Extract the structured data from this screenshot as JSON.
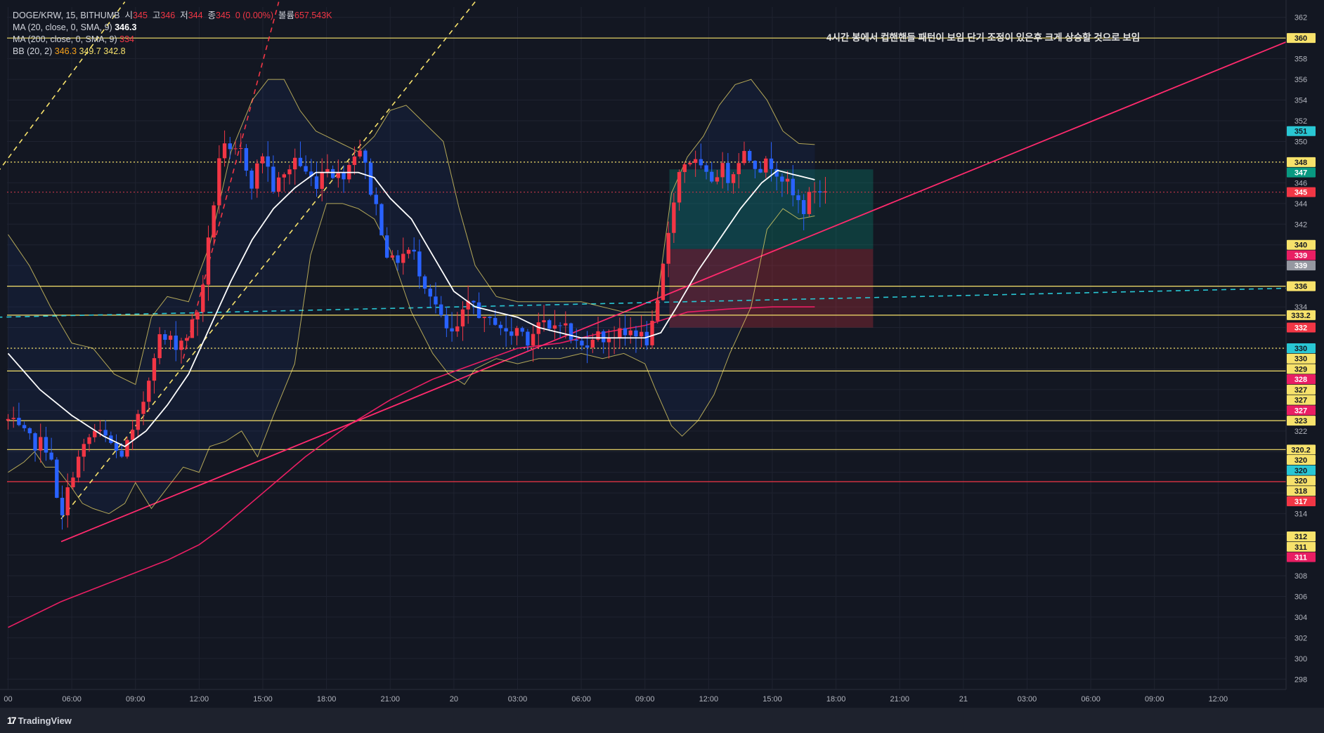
{
  "legend": {
    "symbol": "DOGE/KRW, 15, BITHUMB",
    "o_label": "시",
    "o_value": "345",
    "h_label": "고",
    "h_value": "346",
    "l_label": "저",
    "l_value": "344",
    "c_label": "종",
    "c_value": "345",
    "change": "0 (0.00%)",
    "vol_label": "볼륨",
    "vol_value": "657.543K",
    "ma20_label": "MA (20, close, 0, SMA, 9)",
    "ma20_value": "346.3",
    "ma200_label": "MA (200, close, 0, SMA, 9)",
    "ma200_value": "334",
    "bb_label": "BB (20, 2)",
    "bb_basis": "346.3",
    "bb_upper": "349.7",
    "bb_lower": "342.8"
  },
  "annotation": "4시간 봉에서 컵핸핸들 패턴이 보임  단기 조정이 있은후 크게 상승할 것으로 보임",
  "brand": {
    "logo": "17",
    "name": "TradingView"
  },
  "colors": {
    "bg": "#131722",
    "grid": "#1f2330",
    "up": "#f23645",
    "down": "#2962ff",
    "text": "#b2b5be"
  },
  "chart_data": {
    "type": "candlestick",
    "ylim": [
      297,
      363
    ],
    "y_ticks": [
      298,
      300,
      302,
      304,
      306,
      308,
      310,
      312,
      314,
      316,
      318,
      320,
      322,
      324,
      326,
      328,
      330,
      332,
      334,
      336,
      338,
      340,
      342,
      344,
      346,
      348,
      350,
      352,
      354,
      356,
      358,
      360,
      362
    ],
    "x_ticks": [
      {
        "t": 0,
        "label": "00"
      },
      {
        "t": 6,
        "label": "06:00"
      },
      {
        "t": 12,
        "label": "09:00"
      },
      {
        "t": 18,
        "label": "12:00"
      },
      {
        "t": 24,
        "label": "15:00"
      },
      {
        "t": 30,
        "label": "18:00"
      },
      {
        "t": 36,
        "label": "21:00"
      },
      {
        "t": 42,
        "label": "20"
      },
      {
        "t": 48,
        "label": "03:00"
      },
      {
        "t": 54,
        "label": "06:00"
      },
      {
        "t": 60,
        "label": "09:00"
      },
      {
        "t": 66,
        "label": "12:00"
      },
      {
        "t": 72,
        "label": "15:00"
      },
      {
        "t": 78,
        "label": "18:00"
      },
      {
        "t": 84,
        "label": "21:00"
      },
      {
        "t": 90,
        "label": "21"
      },
      {
        "t": 96,
        "label": "03:00"
      },
      {
        "t": 102,
        "label": "06:00"
      },
      {
        "t": 108,
        "label": "09:00"
      },
      {
        "t": 114,
        "label": "12:00"
      }
    ],
    "price_keypoints": [
      [
        0,
        323.0
      ],
      [
        2,
        321.0
      ],
      [
        4,
        320.5
      ],
      [
        4.5,
        315.5
      ],
      [
        5,
        313.0
      ],
      [
        6,
        318.0
      ],
      [
        8,
        322.0
      ],
      [
        9.5,
        321.0
      ],
      [
        10.5,
        319.5
      ],
      [
        12,
        322.0
      ],
      [
        13,
        326.0
      ],
      [
        14,
        331.0
      ],
      [
        16,
        330.5
      ],
      [
        17,
        331.5
      ],
      [
        18,
        334.0
      ],
      [
        19,
        341.0
      ],
      [
        20,
        349.5
      ],
      [
        21,
        348.5
      ],
      [
        22,
        349.0
      ],
      [
        23,
        346.0
      ],
      [
        24,
        349.0
      ],
      [
        25,
        345.5
      ],
      [
        26,
        346.5
      ],
      [
        27,
        348.5
      ],
      [
        28,
        347.0
      ],
      [
        29,
        346.0
      ],
      [
        30,
        348.0
      ],
      [
        31,
        346.5
      ],
      [
        32,
        347.5
      ],
      [
        33,
        350.0
      ],
      [
        34,
        346.0
      ],
      [
        35,
        342.5
      ],
      [
        36,
        338.0
      ],
      [
        37,
        339.0
      ],
      [
        38,
        339.5
      ],
      [
        39,
        337.0
      ],
      [
        40,
        335.0
      ],
      [
        41,
        332.0
      ],
      [
        42,
        331.0
      ],
      [
        43,
        333.5
      ],
      [
        44,
        334.5
      ],
      [
        45,
        332.0
      ],
      [
        46,
        333.0
      ],
      [
        47,
        331.0
      ],
      [
        48,
        332.0
      ],
      [
        49,
        331.0
      ],
      [
        50,
        332.5
      ],
      [
        51,
        331.5
      ],
      [
        52,
        333.0
      ],
      [
        53,
        331.0
      ],
      [
        54,
        330.0
      ],
      [
        55,
        331.5
      ],
      [
        56,
        331.0
      ],
      [
        57,
        331.5
      ],
      [
        58,
        331.0
      ],
      [
        59,
        332.0
      ],
      [
        60,
        330.5
      ],
      [
        61,
        332.5
      ],
      [
        62,
        340.0
      ],
      [
        63,
        346.5
      ],
      [
        64,
        348.5
      ],
      [
        65,
        347.5
      ],
      [
        66,
        346.0
      ],
      [
        67,
        347.5
      ],
      [
        68,
        346.5
      ],
      [
        69,
        349.0
      ],
      [
        70,
        348.5
      ],
      [
        71,
        347.5
      ],
      [
        72,
        348.0
      ],
      [
        73,
        346.5
      ],
      [
        74,
        344.5
      ],
      [
        75,
        343.5
      ],
      [
        76,
        345.5
      ],
      [
        77,
        345.0
      ]
    ],
    "candle_count": 152,
    "last_candle_t": 77,
    "ma20_keypoints": [
      [
        0,
        329.5
      ],
      [
        3,
        326.0
      ],
      [
        6,
        323.5
      ],
      [
        9,
        321.5
      ],
      [
        11,
        320.5
      ],
      [
        13,
        322.0
      ],
      [
        15,
        324.5
      ],
      [
        17,
        327.5
      ],
      [
        19,
        332.0
      ],
      [
        21,
        336.5
      ],
      [
        23,
        340.5
      ],
      [
        25,
        343.5
      ],
      [
        27,
        345.5
      ],
      [
        29,
        347.0
      ],
      [
        31,
        347.0
      ],
      [
        33,
        347.0
      ],
      [
        34.5,
        346.5
      ],
      [
        36,
        344.5
      ],
      [
        38,
        342.5
      ],
      [
        40,
        339.0
      ],
      [
        42,
        335.5
      ],
      [
        44,
        334.0
      ],
      [
        46,
        333.5
      ],
      [
        48,
        333.0
      ],
      [
        50,
        332.0
      ],
      [
        52,
        331.5
      ],
      [
        54,
        331.0
      ],
      [
        56,
        331.0
      ],
      [
        58,
        331.0
      ],
      [
        60,
        331.0
      ],
      [
        61.5,
        331.5
      ],
      [
        63,
        334.0
      ],
      [
        65,
        337.5
      ],
      [
        67,
        340.5
      ],
      [
        69,
        343.5
      ],
      [
        71,
        346.0
      ],
      [
        72.5,
        347.2
      ],
      [
        74,
        346.8
      ],
      [
        76,
        346.3
      ]
    ],
    "bb_upper_keypoints": [
      [
        0,
        341.0
      ],
      [
        2,
        338.0
      ],
      [
        4,
        334.0
      ],
      [
        6,
        330.5
      ],
      [
        8,
        330.0
      ],
      [
        10,
        327.5
      ],
      [
        12,
        326.5
      ],
      [
        13.5,
        333.0
      ],
      [
        15,
        335.0
      ],
      [
        17,
        334.5
      ],
      [
        19,
        340.0
      ],
      [
        21,
        349.0
      ],
      [
        23,
        354.0
      ],
      [
        24.5,
        356.0
      ],
      [
        26,
        356.0
      ],
      [
        27.5,
        353.0
      ],
      [
        29,
        351.0
      ],
      [
        31,
        350.0
      ],
      [
        33,
        349.0
      ],
      [
        34.5,
        350.5
      ],
      [
        36,
        353.0
      ],
      [
        37.5,
        353.5
      ],
      [
        39,
        352.0
      ],
      [
        41,
        350.0
      ],
      [
        42.5,
        343.5
      ],
      [
        44,
        338.0
      ],
      [
        46,
        335.0
      ],
      [
        48,
        334.5
      ],
      [
        50,
        334.5
      ],
      [
        52,
        334.5
      ],
      [
        54,
        334.5
      ],
      [
        56,
        334.0
      ],
      [
        58,
        333.5
      ],
      [
        60,
        333.5
      ],
      [
        61,
        333.5
      ],
      [
        62.5,
        345.0
      ],
      [
        64,
        348.5
      ],
      [
        65.5,
        350.5
      ],
      [
        67,
        353.5
      ],
      [
        68.5,
        355.5
      ],
      [
        70,
        356.0
      ],
      [
        71.5,
        354.0
      ],
      [
        73,
        351.0
      ],
      [
        74.5,
        349.8
      ],
      [
        76,
        349.7
      ]
    ],
    "bb_lower_keypoints": [
      [
        0,
        318.0
      ],
      [
        1.5,
        319.0
      ],
      [
        2.5,
        320.0
      ],
      [
        3.5,
        318.5
      ],
      [
        4.5,
        318.5
      ],
      [
        6,
        316.5
      ],
      [
        7,
        315.0
      ],
      [
        8,
        314.5
      ],
      [
        9.5,
        314.0
      ],
      [
        11,
        315.0
      ],
      [
        12,
        317.0
      ],
      [
        13.5,
        314.5
      ],
      [
        15,
        316.5
      ],
      [
        16.5,
        318.5
      ],
      [
        18,
        318.0
      ],
      [
        19,
        320.5
      ],
      [
        20.5,
        321.0
      ],
      [
        22,
        322.0
      ],
      [
        23.5,
        319.5
      ],
      [
        25,
        323.5
      ],
      [
        27,
        328.5
      ],
      [
        28.5,
        339.0
      ],
      [
        30,
        344.0
      ],
      [
        31.5,
        344.0
      ],
      [
        33,
        343.5
      ],
      [
        34.5,
        342.5
      ],
      [
        36,
        339.5
      ],
      [
        38,
        333.5
      ],
      [
        40,
        329.5
      ],
      [
        41.5,
        327.5
      ],
      [
        43,
        326.5
      ],
      [
        44,
        328.0
      ],
      [
        46,
        329.0
      ],
      [
        48,
        328.5
      ],
      [
        50,
        329.0
      ],
      [
        52,
        329.0
      ],
      [
        54,
        329.5
      ],
      [
        56,
        329.0
      ],
      [
        58,
        329.5
      ],
      [
        60,
        328.5
      ],
      [
        61,
        326.0
      ],
      [
        62.5,
        322.5
      ],
      [
        63.5,
        321.5
      ],
      [
        65,
        323.0
      ],
      [
        66.5,
        325.5
      ],
      [
        68,
        329.5
      ],
      [
        70,
        334.0
      ],
      [
        71.5,
        341.5
      ],
      [
        73,
        343.5
      ],
      [
        74.5,
        342.5
      ],
      [
        76,
        342.8
      ]
    ],
    "ma200_keypoints": [
      [
        0,
        303.0
      ],
      [
        5,
        305.5
      ],
      [
        10,
        307.5
      ],
      [
        15,
        309.5
      ],
      [
        18,
        311.0
      ],
      [
        20,
        312.5
      ],
      [
        24,
        316.0
      ],
      [
        28,
        319.5
      ],
      [
        32,
        322.5
      ],
      [
        36,
        325.0
      ],
      [
        40,
        327.0
      ],
      [
        44,
        328.5
      ],
      [
        48,
        330.0
      ],
      [
        52,
        330.5
      ],
      [
        56,
        331.5
      ],
      [
        60,
        332.2
      ],
      [
        64,
        333.5
      ],
      [
        68,
        333.8
      ],
      [
        72,
        334.0
      ],
      [
        74,
        334.0
      ],
      [
        76,
        334.0
      ]
    ],
    "horizontal_levels": [
      {
        "price": 360,
        "color": "#f7e26b",
        "style": "solid"
      },
      {
        "price": 348,
        "color": "#f7e26b",
        "style": "dotted"
      },
      {
        "price": 336,
        "color": "#f7e26b",
        "style": "solid"
      },
      {
        "price": 333.2,
        "color": "#f7e26b",
        "style": "solid"
      },
      {
        "price": 330,
        "color": "#f7e26b",
        "style": "dotted"
      },
      {
        "price": 327.8,
        "color": "#f7e26b",
        "style": "solid"
      },
      {
        "price": 323,
        "color": "#f7e26b",
        "style": "solid"
      },
      {
        "price": 320.2,
        "color": "#f7e26b",
        "style": "solid"
      },
      {
        "price": 317.1,
        "color": "#f23645",
        "style": "solid"
      },
      {
        "price": 345.1,
        "color": "#b23445",
        "style": "dotted"
      }
    ],
    "trend_lines": [
      {
        "t1": 5,
        "p1": 311.3,
        "t2": 128,
        "p2": 362.8,
        "color": "#ff2a6d",
        "style": "solid"
      },
      {
        "t1": -1,
        "p1": 333.0,
        "t2": 129,
        "p2": 336.0,
        "color": "#29c7d4",
        "style": "dashed"
      },
      {
        "t1": 5,
        "p1": 313.5,
        "t2": 44,
        "p2": 363.5,
        "color": "#f7e26b",
        "style": "dashed"
      },
      {
        "t1": -1,
        "p1": 347.0,
        "t2": 11,
        "p2": 363.5,
        "color": "#f7e26b",
        "style": "dashed"
      },
      {
        "t1": 16.5,
        "p1": 329.0,
        "t2": 25.5,
        "p2": 363.5,
        "color": "#f23645",
        "style": "dashed"
      }
    ],
    "position_box": {
      "t1": 62.3,
      "t2": 81.5,
      "entry": 339.6,
      "target": 347.3,
      "stop": 332.0
    },
    "price_labels": [
      {
        "price": 360,
        "label": "360",
        "bg": "#f7e26b",
        "fg": "#131722"
      },
      {
        "price": 351,
        "label": "351",
        "bg": "#29c7d4",
        "fg": "#131722"
      },
      {
        "price": 348,
        "label": "348",
        "bg": "#f7e26b",
        "fg": "#131722"
      },
      {
        "price": 347,
        "label": "347",
        "bg": "#089981",
        "fg": "#ffffff"
      },
      {
        "price": 345.1,
        "label": "345",
        "bg": "#f23645",
        "fg": "#ffffff"
      },
      {
        "price": 340,
        "label": "340",
        "bg": "#f7e26b",
        "fg": "#131722"
      },
      {
        "price": 339,
        "label": "339",
        "bg": "#e91e63",
        "fg": "#ffffff"
      },
      {
        "price": 338,
        "label": "339",
        "bg": "#9598a1",
        "fg": "#ffffff"
      },
      {
        "price": 336,
        "label": "336",
        "bg": "#f7e26b",
        "fg": "#131722"
      },
      {
        "price": 333.2,
        "label": "333.2",
        "bg": "#f7e26b",
        "fg": "#131722"
      },
      {
        "price": 332,
        "label": "332",
        "bg": "#f23645",
        "fg": "#ffffff"
      },
      {
        "price": 330,
        "label": "330",
        "bg": "#29c7d4",
        "fg": "#131722"
      },
      {
        "price": 329,
        "label": "330",
        "bg": "#f7e26b",
        "fg": "#131722"
      },
      {
        "price": 328,
        "label": "329",
        "bg": "#f7e26b",
        "fg": "#131722"
      },
      {
        "price": 327,
        "label": "328",
        "bg": "#e91e63",
        "fg": "#ffffff"
      },
      {
        "price": 326,
        "label": "327",
        "bg": "#f7e26b",
        "fg": "#131722"
      },
      {
        "price": 325,
        "label": "327",
        "bg": "#f7e26b",
        "fg": "#131722"
      },
      {
        "price": 324,
        "label": "327",
        "bg": "#e91e63",
        "fg": "#ffffff"
      },
      {
        "price": 323,
        "label": "323",
        "bg": "#f7e26b",
        "fg": "#131722"
      },
      {
        "price": 320.2,
        "label": "320.2",
        "bg": "#f7e26b",
        "fg": "#131722"
      },
      {
        "price": 319.2,
        "label": "320",
        "bg": "#f7e26b",
        "fg": "#131722"
      },
      {
        "price": 318.2,
        "label": "320",
        "bg": "#29c7d4",
        "fg": "#131722"
      },
      {
        "price": 317.2,
        "label": "320",
        "bg": "#f7e26b",
        "fg": "#131722"
      },
      {
        "price": 316.2,
        "label": "318",
        "bg": "#f7e26b",
        "fg": "#131722"
      },
      {
        "price": 315.2,
        "label": "317",
        "bg": "#f23645",
        "fg": "#ffffff"
      },
      {
        "price": 311.8,
        "label": "312",
        "bg": "#f7e26b",
        "fg": "#131722"
      },
      {
        "price": 310.8,
        "label": "311",
        "bg": "#f7e26b",
        "fg": "#131722"
      },
      {
        "price": 309.8,
        "label": "311",
        "bg": "#e91e63",
        "fg": "#ffffff"
      }
    ]
  }
}
